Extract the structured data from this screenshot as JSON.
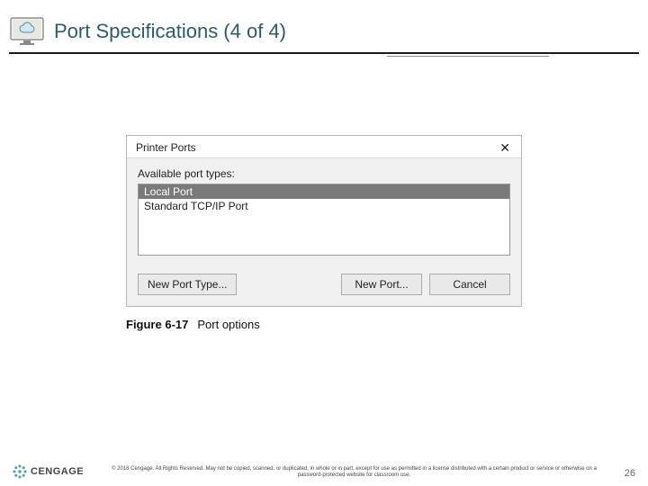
{
  "header": {
    "title": "Port Specifications (4 of 4)"
  },
  "dialog": {
    "title": "Printer Ports",
    "label": "Available port types:",
    "items": [
      "Local Port",
      "Standard TCP/IP Port"
    ],
    "selected_index": 0,
    "buttons": {
      "new_port_type": "New Port Type...",
      "new_port": "New Port...",
      "cancel": "Cancel"
    }
  },
  "figure": {
    "label": "Figure 6-17",
    "caption": "Port options"
  },
  "footer": {
    "brand": "CENGAGE",
    "copyright": "© 2018 Cengage. All Rights Reserved. May not be copied, scanned, or duplicated, in whole or in part, except for use as permitted in a license distributed with a certain product or service or otherwise on a password-protected website for classroom use.",
    "page": "26"
  }
}
